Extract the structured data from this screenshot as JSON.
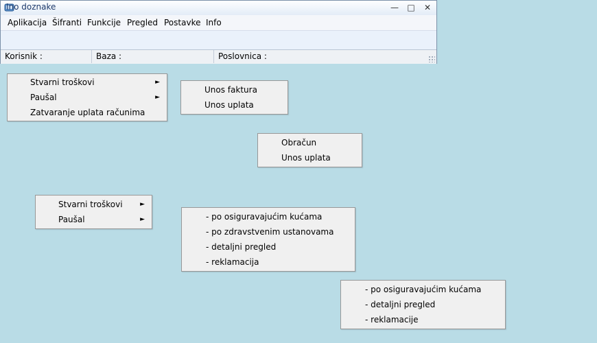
{
  "window": {
    "title": "Ino doznake",
    "minimize": "—",
    "maximize": "□",
    "close": "✕"
  },
  "menubar": [
    {
      "label": "Aplikacija"
    },
    {
      "label": "Šifranti"
    },
    {
      "label": "Funkcije"
    },
    {
      "label": "Pregled"
    },
    {
      "label": "Postavke"
    },
    {
      "label": "Info"
    }
  ],
  "statusbar": {
    "user_label": "Korisnik :",
    "db_label": "Baza :",
    "branch_label": "Poslovnica :"
  },
  "menus": {
    "funkcije_main": {
      "items": [
        {
          "label": "Stvarni troškovi",
          "submenu_arrow": "►"
        },
        {
          "label": "Paušal",
          "submenu_arrow": "►"
        },
        {
          "label": "Zatvaranje uplata računima"
        }
      ]
    },
    "stvarni_troskovi_sub": {
      "items": [
        {
          "label": "Unos faktura"
        },
        {
          "label": "Unos uplata"
        }
      ]
    },
    "pausal_sub": {
      "items": [
        {
          "label": "Obračun"
        },
        {
          "label": "Unos uplata"
        }
      ]
    },
    "pregled_main": {
      "items": [
        {
          "label": "Stvarni troškovi",
          "submenu_arrow": "►"
        },
        {
          "label": "Paušal",
          "submenu_arrow": "►"
        }
      ]
    },
    "pregled_stvarni_sub": {
      "items": [
        {
          "label": "- po osiguravajućim kućama"
        },
        {
          "label": "- po zdravstvenim ustanovama"
        },
        {
          "label": "- detaljni pregled"
        },
        {
          "label": "- reklamacija"
        }
      ]
    },
    "pregled_pausal_sub": {
      "items": [
        {
          "label": "- po osiguravajućim kućama"
        },
        {
          "label": "- detaljni pregled"
        },
        {
          "label": "- reklamacije"
        }
      ]
    }
  }
}
